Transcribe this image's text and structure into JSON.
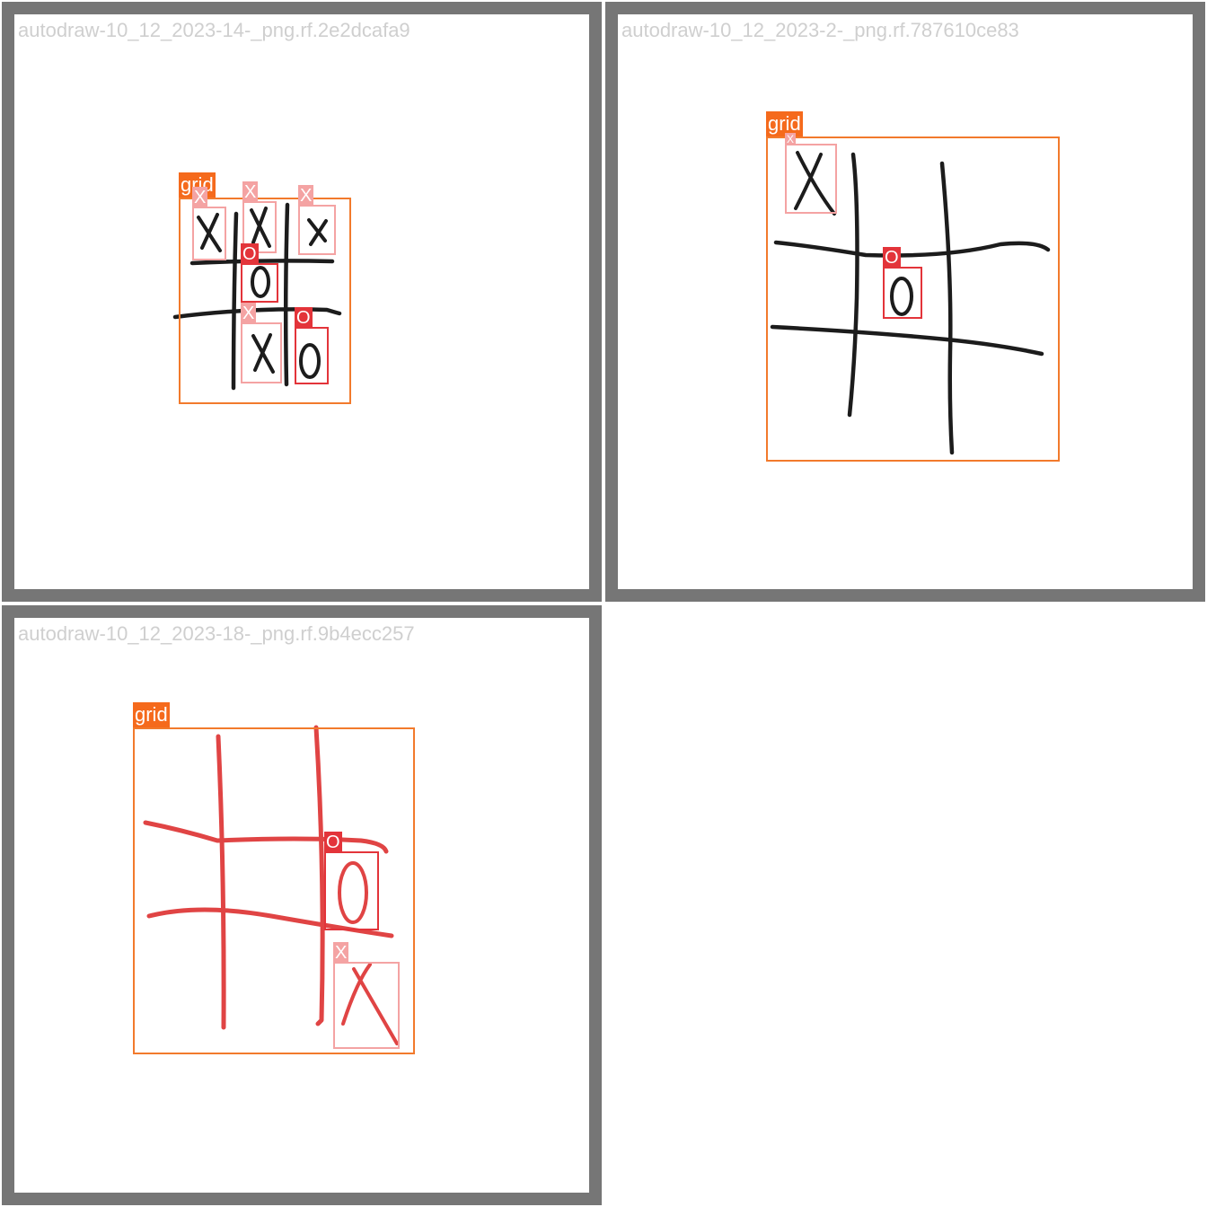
{
  "frame_color": "#767676",
  "colors": {
    "grid": "#f56a1c",
    "x": "#f4a3a3",
    "o": "#e3343a",
    "ink_black": "#1c1c1c",
    "ink_red": "#e04444"
  },
  "panels": [
    {
      "file_name": "autodraw-10_12_2023-14-_png.rf.2e2dcafa9",
      "labels": {
        "grid": "grid",
        "x1": "X",
        "x2": "X",
        "x3": "X",
        "x4": "X",
        "o1": "O",
        "o2": "O"
      }
    },
    {
      "file_name": "autodraw-10_12_2023-2-_png.rf.787610ce83",
      "labels": {
        "grid": "grid",
        "x1": "X",
        "o1": "O"
      }
    },
    {
      "file_name": "autodraw-10_12_2023-18-_png.rf.9b4ecc257",
      "labels": {
        "grid": "grid",
        "o1": "O",
        "x1": "X"
      }
    }
  ]
}
